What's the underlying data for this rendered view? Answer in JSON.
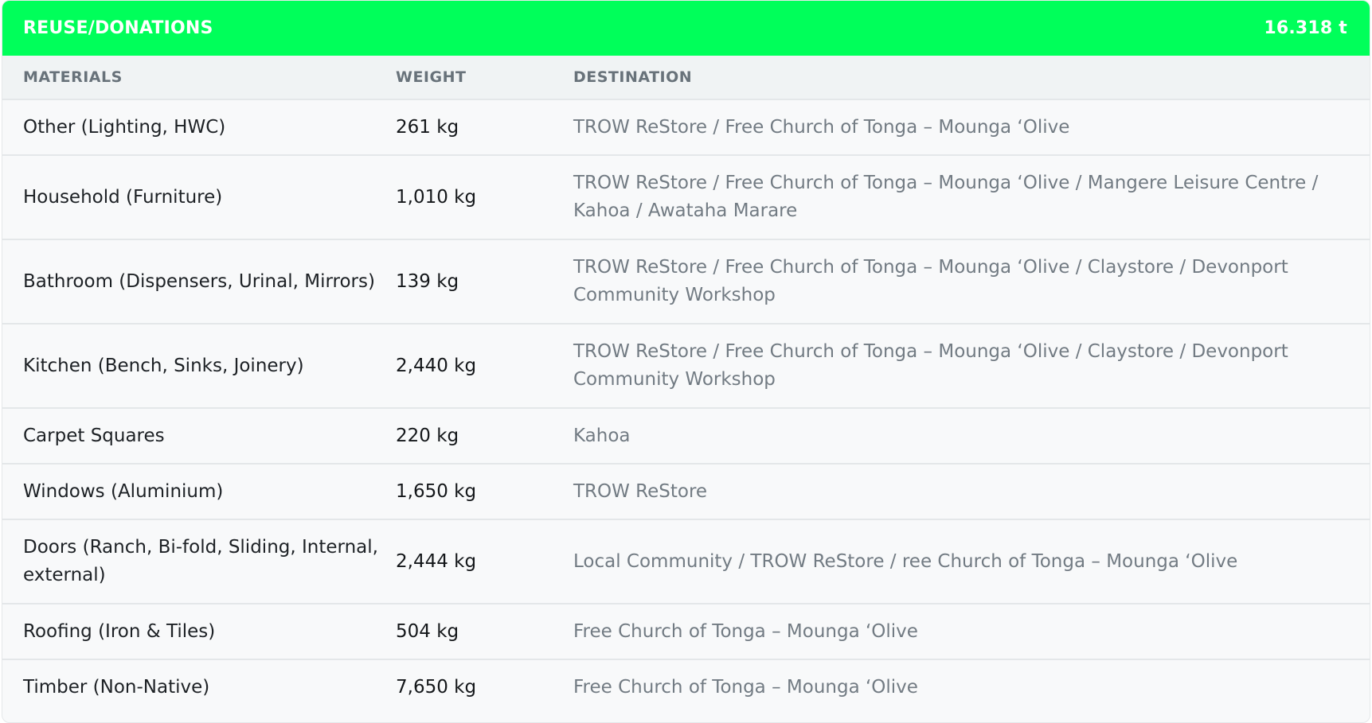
{
  "header": {
    "title": "REUSE/DONATIONS",
    "total": "16.318 t"
  },
  "columns": {
    "materials": "MATERIALS",
    "weight": "WEIGHT",
    "destination": "DESTINATION"
  },
  "rows": [
    {
      "material": "Other (Lighting, HWC)",
      "weight": "261 kg",
      "destination": "TROW ReStore / Free Church of Tonga – Mounga ‘Olive"
    },
    {
      "material": "Household (Furniture)",
      "weight": "1,010 kg",
      "destination": "TROW ReStore / Free Church of Tonga – Mounga ‘Olive / Mangere Leisure Centre / Kahoa / Awataha Marare"
    },
    {
      "material": "Bathroom (Dispensers, Urinal, Mirrors)",
      "weight": "139 kg",
      "destination": "TROW ReStore / Free Church of Tonga – Mounga ‘Olive / Claystore / Devonport Community Workshop"
    },
    {
      "material": "Kitchen (Bench, Sinks, Joinery)",
      "weight": "2,440 kg",
      "destination": "TROW ReStore / Free Church of Tonga – Mounga ‘Olive / Claystore / Devonport Community Workshop"
    },
    {
      "material": "Carpet Squares",
      "weight": "220 kg",
      "destination": "Kahoa"
    },
    {
      "material": "Windows (Aluminium)",
      "weight": "1,650 kg",
      "destination": "TROW ReStore"
    },
    {
      "material": "Doors (Ranch, Bi-fold, Sliding, Internal, external)",
      "weight": "2,444 kg",
      "destination": "Local Community / TROW ReStore / ree Church of Tonga – Mounga ‘Olive"
    },
    {
      "material": "Roofing (Iron & Tiles)",
      "weight": "504 kg",
      "destination": "Free Church of Tonga – Mounga ‘Olive"
    },
    {
      "material": "Timber (Non-Native)",
      "weight": "7,650 kg",
      "destination": "Free Church of Tonga – Mounga ‘Olive"
    }
  ]
}
